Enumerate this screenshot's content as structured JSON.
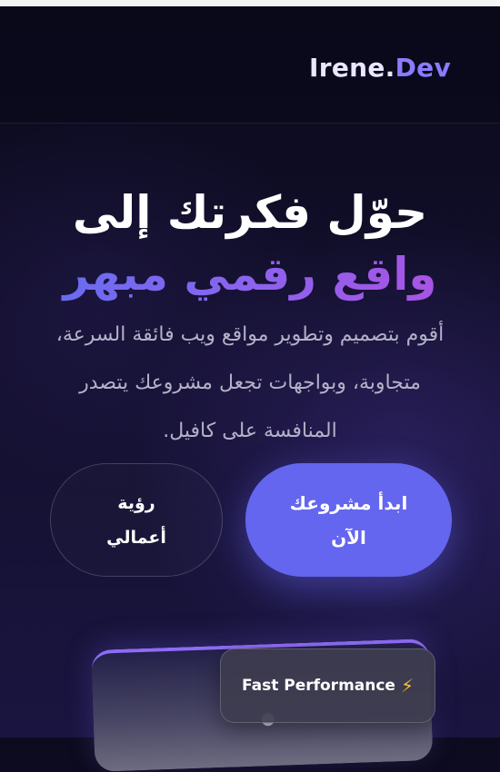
{
  "header": {
    "logo_part1": "Irene.",
    "logo_part2": "Dev"
  },
  "hero": {
    "title_line1": "حوّل فكرتك إلى",
    "title_line2": "واقع رقمي مبهر",
    "description": "أقوم بتصميم وتطوير مواقع ويب فائقة السرعة، متجاوبة، وبواجهات تجعل مشروعك يتصدر المنافسة على كافيل."
  },
  "buttons": {
    "primary_label": "ابدأ مشروعك الآن",
    "secondary_label": "رؤية أعمالي"
  },
  "badge": {
    "label": "Fast Performance",
    "icon": "lightning-icon",
    "icon_glyph": "⚡"
  },
  "colors": {
    "accent": "#6466ef",
    "gradient_start": "#5e6ff0",
    "gradient_end": "#b14fe0",
    "background": "#0d0b1f"
  }
}
